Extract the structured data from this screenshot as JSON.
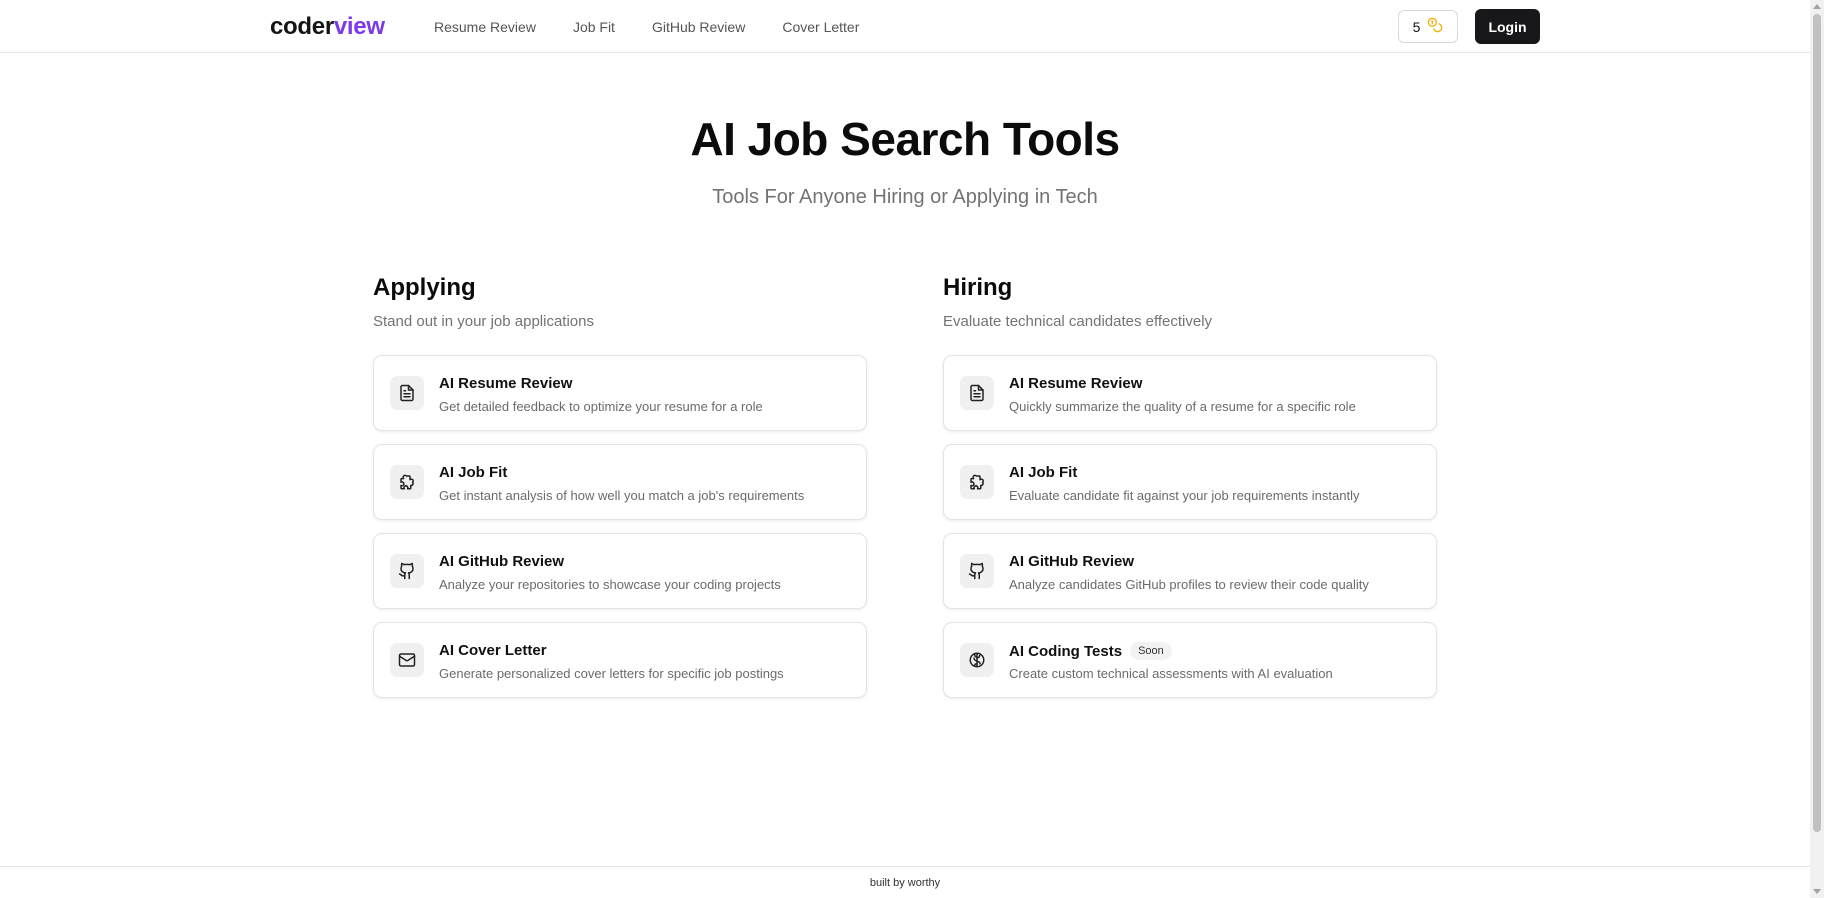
{
  "header": {
    "logo_part1": "coder",
    "logo_part2": "view",
    "nav": [
      "Resume Review",
      "Job Fit",
      "GitHub Review",
      "Cover Letter"
    ],
    "credits": "5",
    "credits_icon": "coins-icon",
    "login_label": "Login"
  },
  "hero": {
    "title": "AI Job Search Tools",
    "subtitle": "Tools For Anyone Hiring or Applying in Tech"
  },
  "applying": {
    "heading": "Applying",
    "subheading": "Stand out in your job applications",
    "cards": [
      {
        "title": "AI Resume Review",
        "desc": "Get detailed feedback to optimize your resume for a role",
        "icon": "file-text-icon"
      },
      {
        "title": "AI Job Fit",
        "desc": "Get instant analysis of how well you match a job's requirements",
        "icon": "puzzle-icon"
      },
      {
        "title": "AI GitHub Review",
        "desc": "Analyze your repositories to showcase your coding projects",
        "icon": "github-icon"
      },
      {
        "title": "AI Cover Letter",
        "desc": "Generate personalized cover letters for specific job postings",
        "icon": "mail-icon"
      }
    ]
  },
  "hiring": {
    "heading": "Hiring",
    "subheading": "Evaluate technical candidates effectively",
    "cards": [
      {
        "title": "AI Resume Review",
        "desc": "Quickly summarize the quality of a resume for a specific role",
        "icon": "file-text-icon"
      },
      {
        "title": "AI Job Fit",
        "desc": "Evaluate candidate fit against your job requirements instantly",
        "icon": "puzzle-icon"
      },
      {
        "title": "AI GitHub Review",
        "desc": "Analyze candidates GitHub profiles to review their code quality",
        "icon": "github-icon"
      },
      {
        "title": "AI Coding Tests",
        "badge": "Soon",
        "desc": "Create custom technical assessments with AI evaluation",
        "icon": "brain-icon"
      }
    ]
  },
  "footer": {
    "text": "built by worthy"
  },
  "colors": {
    "brand_purple": "#7c3aed",
    "login_bg": "#18181b",
    "coin_gold": "#eab308"
  }
}
